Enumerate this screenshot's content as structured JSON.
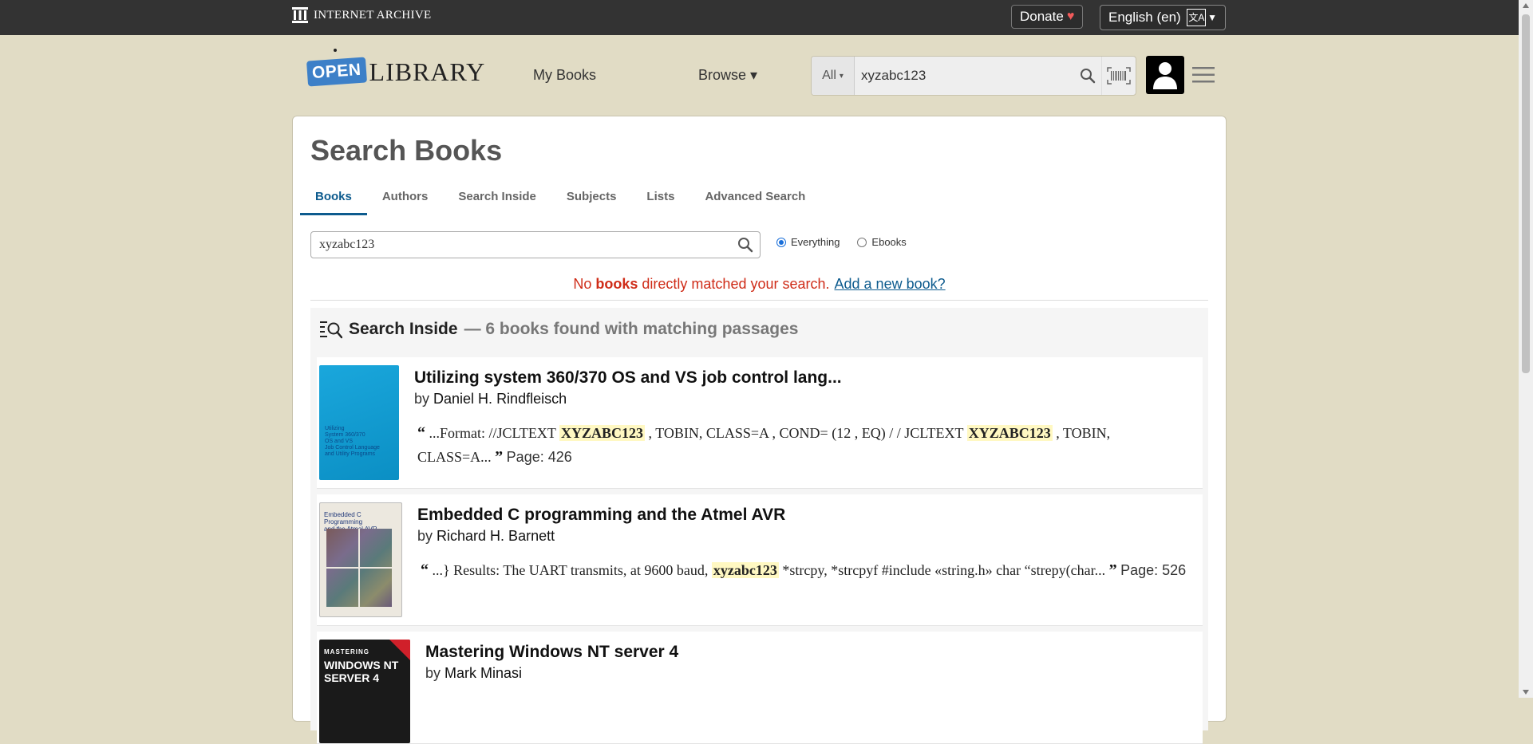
{
  "topbar": {
    "logo_text": "INTERNET ARCHIVE",
    "donate_label": "Donate",
    "donate_heart": "♥",
    "language_label": "English (en)",
    "language_icon_text": "文A"
  },
  "header": {
    "logo_open": "OPEN",
    "logo_library": "LIBRARY",
    "nav_mybooks": "My Books",
    "nav_browse": "Browse ▾",
    "search_scope": "All",
    "search_value": "xyzabc123"
  },
  "main": {
    "title": "Search Books",
    "tabs": [
      {
        "label": "Books",
        "active": true
      },
      {
        "label": "Authors"
      },
      {
        "label": "Search Inside"
      },
      {
        "label": "Subjects"
      },
      {
        "label": "Lists"
      },
      {
        "label": "Advanced Search"
      }
    ],
    "search_value": "xyzabc123",
    "radio_everything": "Everything",
    "radio_ebooks": "Ebooks",
    "no_match": {
      "pre": "No ",
      "bold": "books",
      "post": " directly matched your search.",
      "link": "Add a new book?"
    }
  },
  "search_inside": {
    "title": "Search Inside",
    "count_text": "— 6 books found with matching passages",
    "results": [
      {
        "title": "Utilizing system 360/370 OS and VS job control lang...",
        "by": "by",
        "author": "Daniel H. Rindfleisch",
        "snip_1": "...Format: //JCLTEXT ",
        "hl_1": "XYZABC123",
        "snip_2": " , TOBIN, CLASS=A , COND= (12 , EQ) / / JCLTEXT ",
        "hl_2": "XYZABC123",
        "snip_3": " , TOBIN, CLASS=A... ",
        "page": "Page: 426",
        "cover_lines": [
          "Utilizing",
          "System 360/370",
          "OS and VS",
          "Job Control Language",
          "and Utility Programs"
        ]
      },
      {
        "title": "Embedded C programming and the Atmel AVR",
        "by": "by",
        "author": "Richard H. Barnett",
        "snip_1": "...} Results: The UART transmits, at 9600 baud, ",
        "hl_1": "xyzabc123",
        "snip_2": " *strcpy, *strcpyf #include «string.h» char “strepy(char... ",
        "page": "Page: 526",
        "cover_lines": [
          "Embedded C Programming",
          "and the Atmel AVR"
        ]
      },
      {
        "title": "Mastering Windows NT server 4",
        "by": "by",
        "author": "Mark Minasi",
        "cover_lines": [
          "MASTERING",
          "WINDOWS NT",
          "SERVER 4"
        ]
      }
    ]
  },
  "colors": {
    "page_bg": "#e1dcc5",
    "accent": "#0d5b8e",
    "error": "#cf2c18",
    "highlight": "#fff8c2"
  }
}
